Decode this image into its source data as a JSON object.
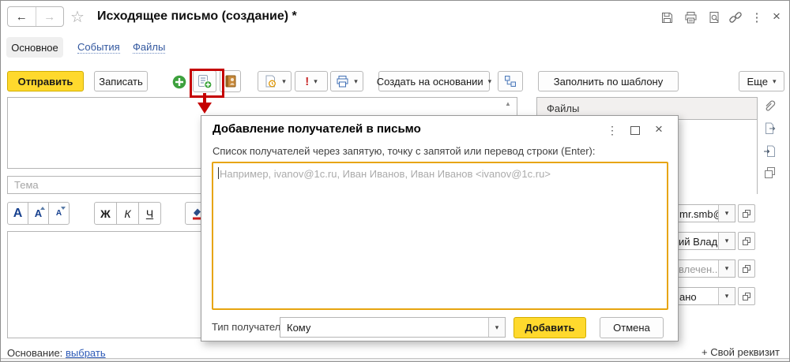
{
  "icons": {
    "back": "←",
    "forward": "→",
    "star": "☆",
    "dots": "⋮",
    "close": "×",
    "scroll_up": "▲",
    "dropdown": "▾",
    "important": "!"
  },
  "header": {
    "title": "Исходящее письмо (создание) *"
  },
  "tabs": [
    {
      "label": "Основное",
      "active": true
    },
    {
      "label": "События",
      "active": false
    },
    {
      "label": "Файлы",
      "active": false
    }
  ],
  "toolbar": {
    "send_label": "Отправить",
    "save_label": "Записать",
    "create_based_on_label": "Создать на основании",
    "fill_template_label": "Заполнить по шаблону",
    "more_label": "Еще"
  },
  "compose": {
    "subject_placeholder": "Тема",
    "format_labels": [
      "А",
      "А",
      "А",
      "Ж",
      "К",
      "Ч"
    ]
  },
  "files_panel": {
    "title": "Файлы"
  },
  "right_fields": [
    {
      "value": "mr.smb@",
      "muted": false
    },
    {
      "value": "ий Влади",
      "muted": false
    },
    {
      "value": "влечен...",
      "muted": true
    },
    {
      "value": "ано",
      "muted": false
    }
  ],
  "footer": {
    "base_label": "Основание:",
    "base_link_label": "выбрать",
    "custom_attribute_label": "+ Свой реквизит"
  },
  "dialog": {
    "title": "Добавление получателей в письмо",
    "hint": "Список получателей через запятую, точку с запятой или перевод строки (Enter):",
    "recipients_placeholder": "Например, ivanov@1c.ru, Иван Иванов, Иван Иванов <ivanov@1c.ru>",
    "type_label": "Тип получателя:",
    "type_value": "Кому",
    "add_label": "Добавить",
    "cancel_label": "Отмена"
  },
  "colors": {
    "accent_yellow": "#ffd92d",
    "focus_border": "#e7a50f",
    "link_blue": "#2e5bb7",
    "annotation_red": "#c50000",
    "plus_green": "#3ea13e"
  }
}
